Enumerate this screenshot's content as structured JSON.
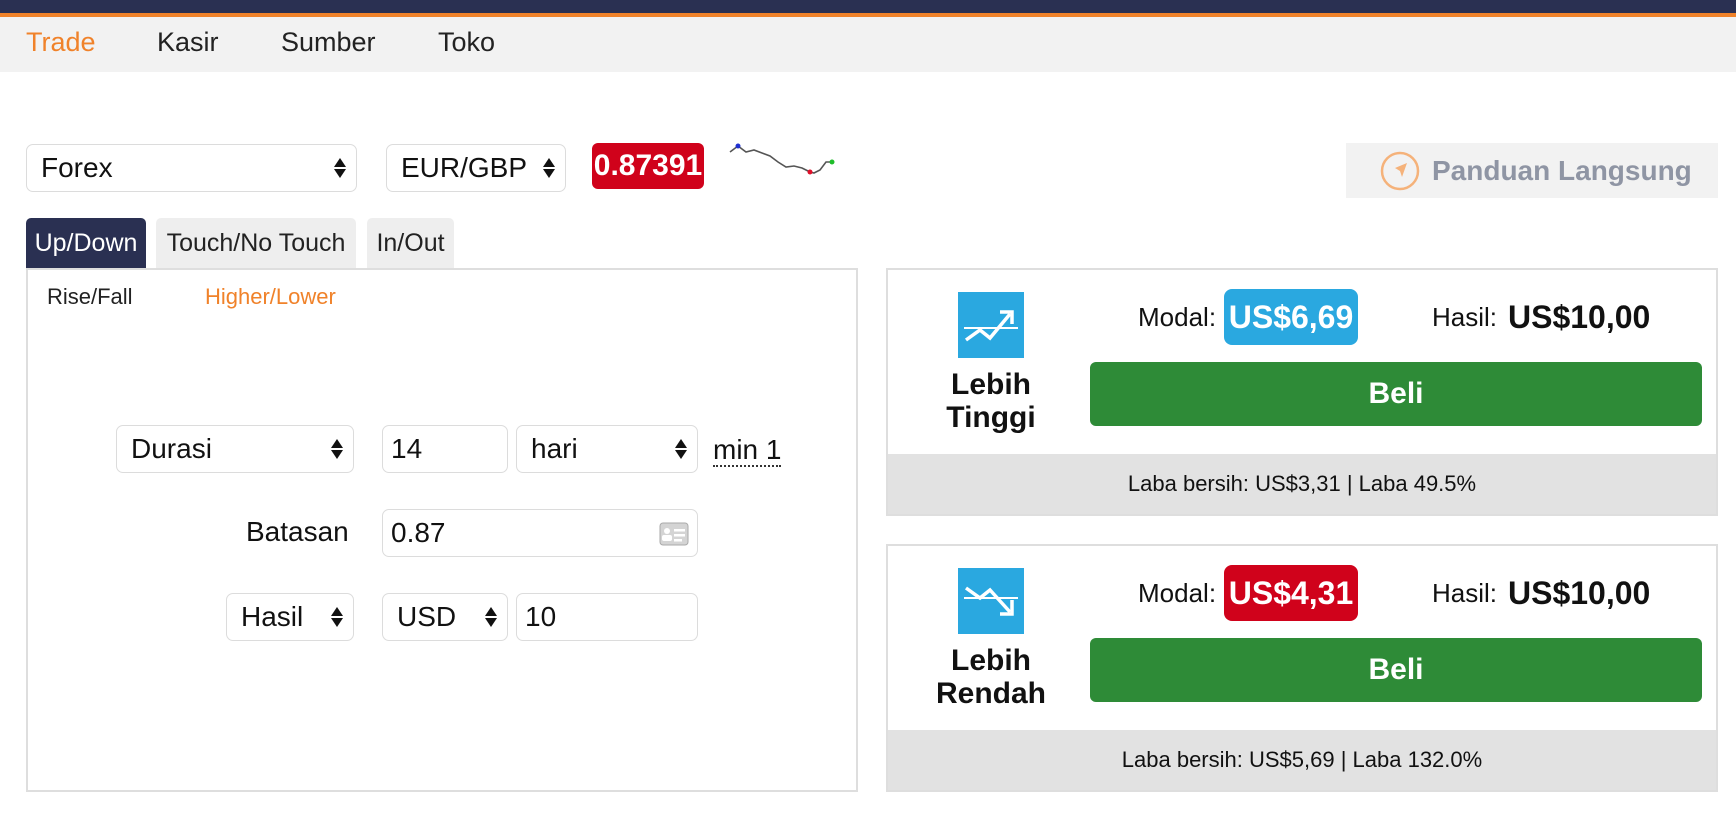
{
  "nav": {
    "items": [
      "Trade",
      "Kasir",
      "Sumber",
      "Toko"
    ]
  },
  "market": {
    "category": "Forex",
    "pair": "EUR/GBP",
    "price": "0.87391",
    "price_color": "#d0021b"
  },
  "guide": {
    "label": "Panduan Langsung"
  },
  "tabs": [
    "Up/Down",
    "Touch/No Touch",
    "In/Out"
  ],
  "subtabs": [
    "Rise/Fall",
    "Higher/Lower"
  ],
  "form": {
    "duration_type": "Durasi",
    "duration_value": "14",
    "duration_unit": "hari",
    "duration_min": "min 1",
    "barrier_label": "Batasan",
    "barrier_value": "0.87",
    "amount_type": "Hasil",
    "currency": "USD",
    "amount": "10"
  },
  "contracts": [
    {
      "title_line1": "Lebih",
      "title_line2": "Tinggi",
      "stake_label": "Modal:",
      "stake": "US$6,69",
      "stake_color": "#2aa8e0",
      "payout_label": "Hasil:",
      "payout": "US$10,00",
      "button": "Beli",
      "footer": "Laba bersih: US$3,31 | Laba 49.5%"
    },
    {
      "title_line1": "Lebih",
      "title_line2": "Rendah",
      "stake_label": "Modal:",
      "stake": "US$4,31",
      "stake_color": "#d0021b",
      "payout_label": "Hasil:",
      "payout": "US$10,00",
      "button": "Beli",
      "footer": "Laba bersih: US$5,69 | Laba 132.0%"
    }
  ],
  "colors": {
    "accent": "#f0822a",
    "navy": "#2a3052",
    "buy": "#2e8b37"
  }
}
